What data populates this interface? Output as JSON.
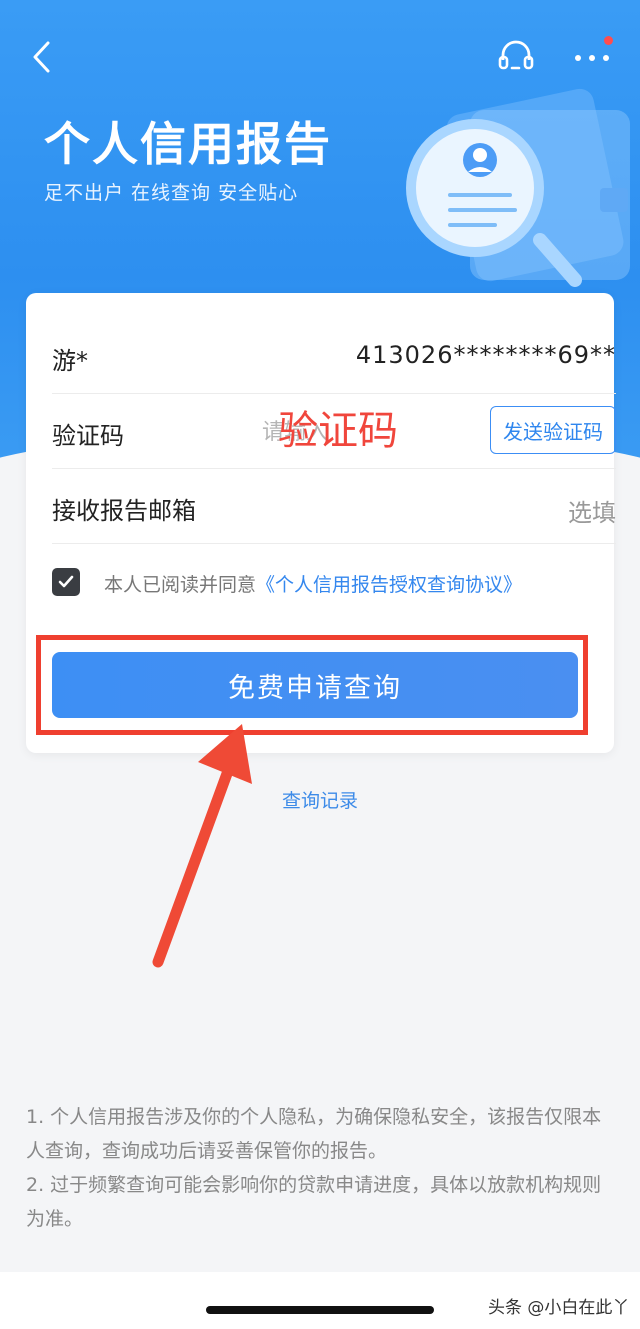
{
  "header": {
    "title": "个人信用报告",
    "subtitle": "足不出户 在线查询 安全贴心"
  },
  "form": {
    "name_label": "游*",
    "id_number": "413026********69**",
    "code_label": "验证码",
    "code_placeholder": "请输入",
    "code_annotation": "验证码",
    "send_code_button": "发送验证码",
    "email_label": "接收报告邮箱",
    "email_placeholder": "选填",
    "agree_prefix": "本人已阅读并同意",
    "agree_link": "《个人信用报告授权查询协议》",
    "agree_checked": true
  },
  "actions": {
    "apply_button": "免费申请查询",
    "history_link": "查询记录"
  },
  "notes": {
    "note1": "1. 个人信用报告涉及你的个人隐私，为确保隐私安全，该报告仅限本人查询，查询成功后请妥善保管你的报告。",
    "note2": "2. 过于频繁查询可能会影响你的贷款申请进度，具体以放款机构规则为准。"
  },
  "watermark": "头条 @小白在此丫",
  "colors": {
    "brand_blue": "#2d8ff0",
    "annotation_red": "#ef3f2f"
  },
  "icons": [
    "back-icon",
    "headset-icon",
    "more-icon",
    "checkmark-icon",
    "credit-report-illustration"
  ]
}
